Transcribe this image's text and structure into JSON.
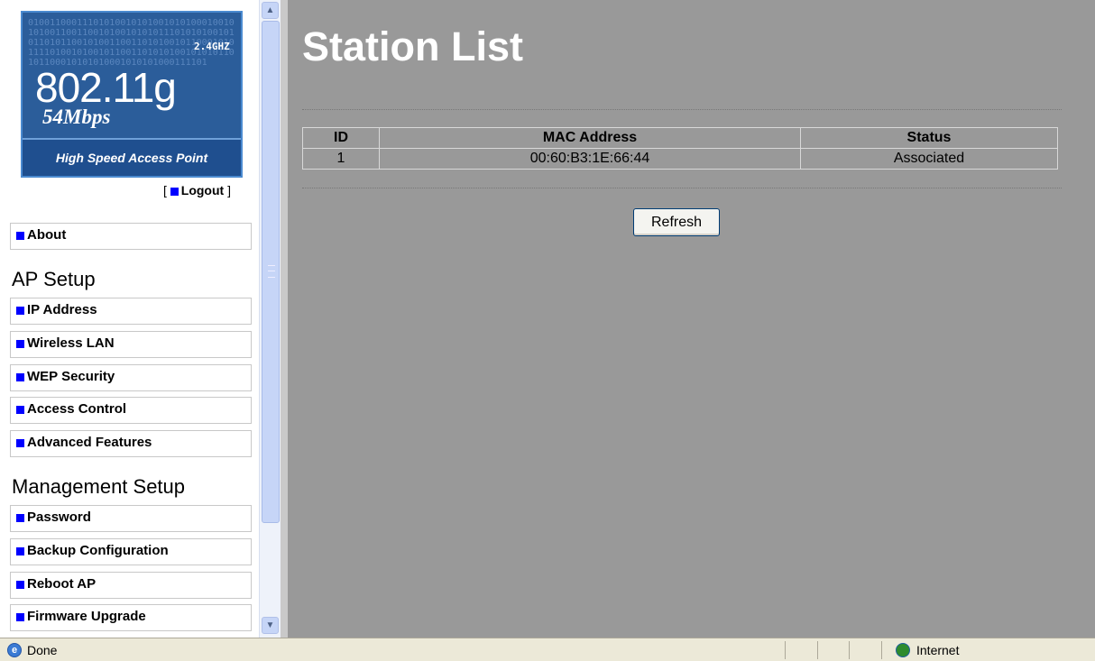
{
  "logo": {
    "binary": "01001100011101010010101001010100010010101001100110010100101010111010101001010110101100101001100110101001011000101011110100101001011001101010100101010110101100010101010001010101000111101",
    "frequency": "2.4GHZ",
    "standard": "802.11g",
    "speed": "54Mbps",
    "tagline": "High Speed Access Point"
  },
  "logout": {
    "open": "[",
    "label": "Logout",
    "close": "]"
  },
  "nav": {
    "about": "About",
    "ap_setup_title": "AP Setup",
    "ap_setup": [
      "IP Address",
      "Wireless LAN",
      "WEP Security",
      "Access Control",
      "Advanced Features"
    ],
    "management_title": "Management Setup",
    "management": [
      "Password",
      "Backup Configuration",
      "Reboot AP",
      "Firmware Upgrade"
    ]
  },
  "main": {
    "title": "Station List",
    "table": {
      "headers": [
        "ID",
        "MAC Address",
        "Status"
      ],
      "rows": [
        [
          "1",
          "00:60:B3:1E:66:44",
          "Associated"
        ]
      ]
    },
    "refresh_label": "Refresh"
  },
  "statusbar": {
    "left": "Done",
    "zone": "Internet"
  },
  "colors": {
    "main_bg": "#999999",
    "bullet": "#0000ff",
    "logo_bg": "#2b5d9a"
  }
}
